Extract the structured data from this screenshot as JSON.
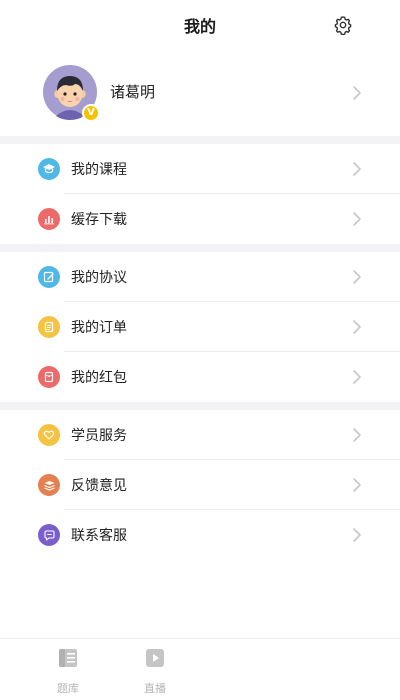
{
  "header": {
    "title": "我的",
    "settings_icon": "gear-icon"
  },
  "profile": {
    "name": "诸葛明",
    "badge": "V",
    "avatar_icon": "avatar-boy-icon"
  },
  "groups": [
    {
      "items": [
        {
          "label": "我的课程",
          "icon": "graduation-cap-icon",
          "color": "#4fb8e6"
        },
        {
          "label": "缓存下载",
          "icon": "bar-chart-icon",
          "color": "#ee6a6a"
        }
      ]
    },
    {
      "items": [
        {
          "label": "我的协议",
          "icon": "edit-doc-icon",
          "color": "#4fb8e6"
        },
        {
          "label": "我的订单",
          "icon": "order-doc-icon",
          "color": "#f5c242"
        },
        {
          "label": "我的红包",
          "icon": "red-packet-icon",
          "color": "#ee6a6a"
        }
      ]
    },
    {
      "items": [
        {
          "label": "学员服务",
          "icon": "heart-icon",
          "color": "#f5c242"
        },
        {
          "label": "反馈意见",
          "icon": "stack-icon",
          "color": "#e58050"
        },
        {
          "label": "联系客服",
          "icon": "chat-bubble-icon",
          "color": "#7a5fcc"
        }
      ]
    }
  ],
  "tabbar": {
    "tabs": [
      {
        "label": "题库",
        "icon": "question-bank-icon"
      },
      {
        "label": "直播",
        "icon": "live-play-icon"
      }
    ]
  },
  "colors": {
    "chevron": "#c7c7c7",
    "band": "#f3f3f5",
    "badge": "#f5c400"
  }
}
